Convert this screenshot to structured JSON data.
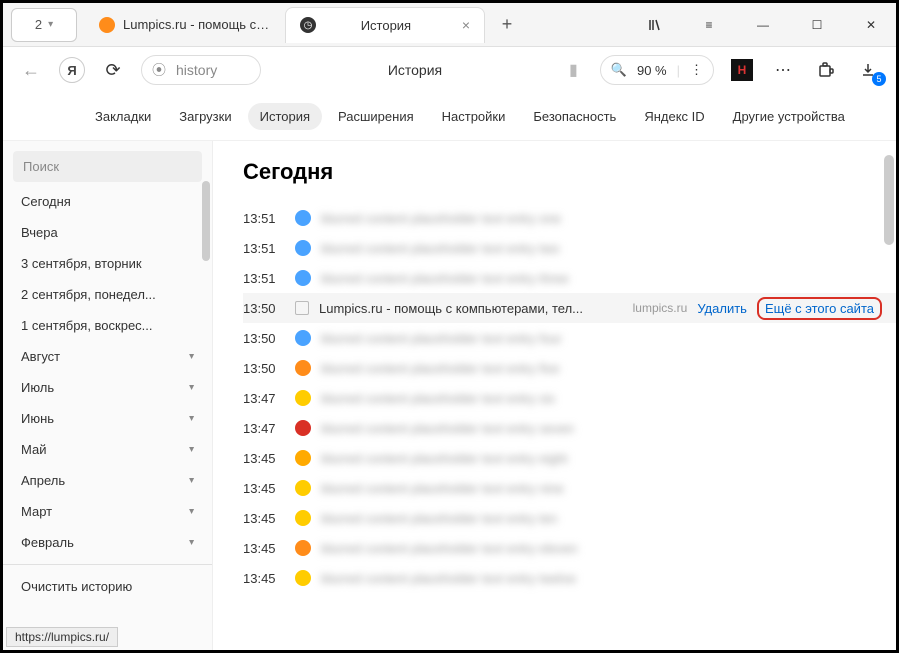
{
  "window": {
    "tab_count": "2",
    "inactive_tab_title": "Lumpics.ru - помощь с ком",
    "active_tab_title": "История",
    "download_badge": "5"
  },
  "toolbar": {
    "url": "history",
    "page_title": "История",
    "zoom": "90 %"
  },
  "nav_tabs": [
    "Закладки",
    "Загрузки",
    "История",
    "Расширения",
    "Настройки",
    "Безопасность",
    "Яндекс ID",
    "Другие устройства"
  ],
  "sidebar": {
    "search_placeholder": "Поиск",
    "items": [
      {
        "label": "Сегодня",
        "expandable": false
      },
      {
        "label": "Вчера",
        "expandable": false
      },
      {
        "label": "3 сентября, вторник",
        "expandable": false
      },
      {
        "label": "2 сентября, понедел...",
        "expandable": false
      },
      {
        "label": "1 сентября, воскрес...",
        "expandable": false
      },
      {
        "label": "Август",
        "expandable": true
      },
      {
        "label": "Июль",
        "expandable": true
      },
      {
        "label": "Июнь",
        "expandable": true
      },
      {
        "label": "Май",
        "expandable": true
      },
      {
        "label": "Апрель",
        "expandable": true
      },
      {
        "label": "Март",
        "expandable": true
      },
      {
        "label": "Февраль",
        "expandable": true
      }
    ],
    "clear_label": "Очистить историю"
  },
  "main": {
    "heading": "Сегодня",
    "rows": [
      {
        "time": "13:51",
        "title": "blurred content placeholder text entry one",
        "fav": "#4aa3ff",
        "blur": true
      },
      {
        "time": "13:51",
        "title": "blurred content placeholder text entry two",
        "fav": "#4aa3ff",
        "blur": true
      },
      {
        "time": "13:51",
        "title": "blurred content placeholder text entry three",
        "fav": "#4aa3ff",
        "blur": true
      },
      {
        "time": "13:50",
        "title": "Lumpics.ru - помощь с компьютерами, тел...",
        "domain": "lumpics.ru",
        "fav": "#fff",
        "blur": false,
        "hovered": true,
        "delete": "Удалить",
        "more": "Ещё с этого сайта"
      },
      {
        "time": "13:50",
        "title": "blurred content placeholder text entry four",
        "fav": "#4aa3ff",
        "blur": true
      },
      {
        "time": "13:50",
        "title": "blurred content placeholder text entry five",
        "fav": "#ff8c1a",
        "blur": true
      },
      {
        "time": "13:47",
        "title": "blurred content placeholder text entry six",
        "fav": "#ffcc00",
        "blur": true
      },
      {
        "time": "13:47",
        "title": "blurred content placeholder text entry seven",
        "fav": "#d93025",
        "blur": true
      },
      {
        "time": "13:45",
        "title": "blurred content placeholder text entry eight",
        "fav": "#ffaa00",
        "blur": true
      },
      {
        "time": "13:45",
        "title": "blurred content placeholder text entry nine",
        "fav": "#ffcc00",
        "blur": true
      },
      {
        "time": "13:45",
        "title": "blurred content placeholder text entry ten",
        "fav": "#ffcc00",
        "blur": true
      },
      {
        "time": "13:45",
        "title": "blurred content placeholder text entry eleven",
        "fav": "#ff8c1a",
        "blur": true
      },
      {
        "time": "13:45",
        "title": "blurred content placeholder text entry twelve",
        "fav": "#ffcc00",
        "blur": true
      }
    ]
  },
  "status": "https://lumpics.ru/"
}
